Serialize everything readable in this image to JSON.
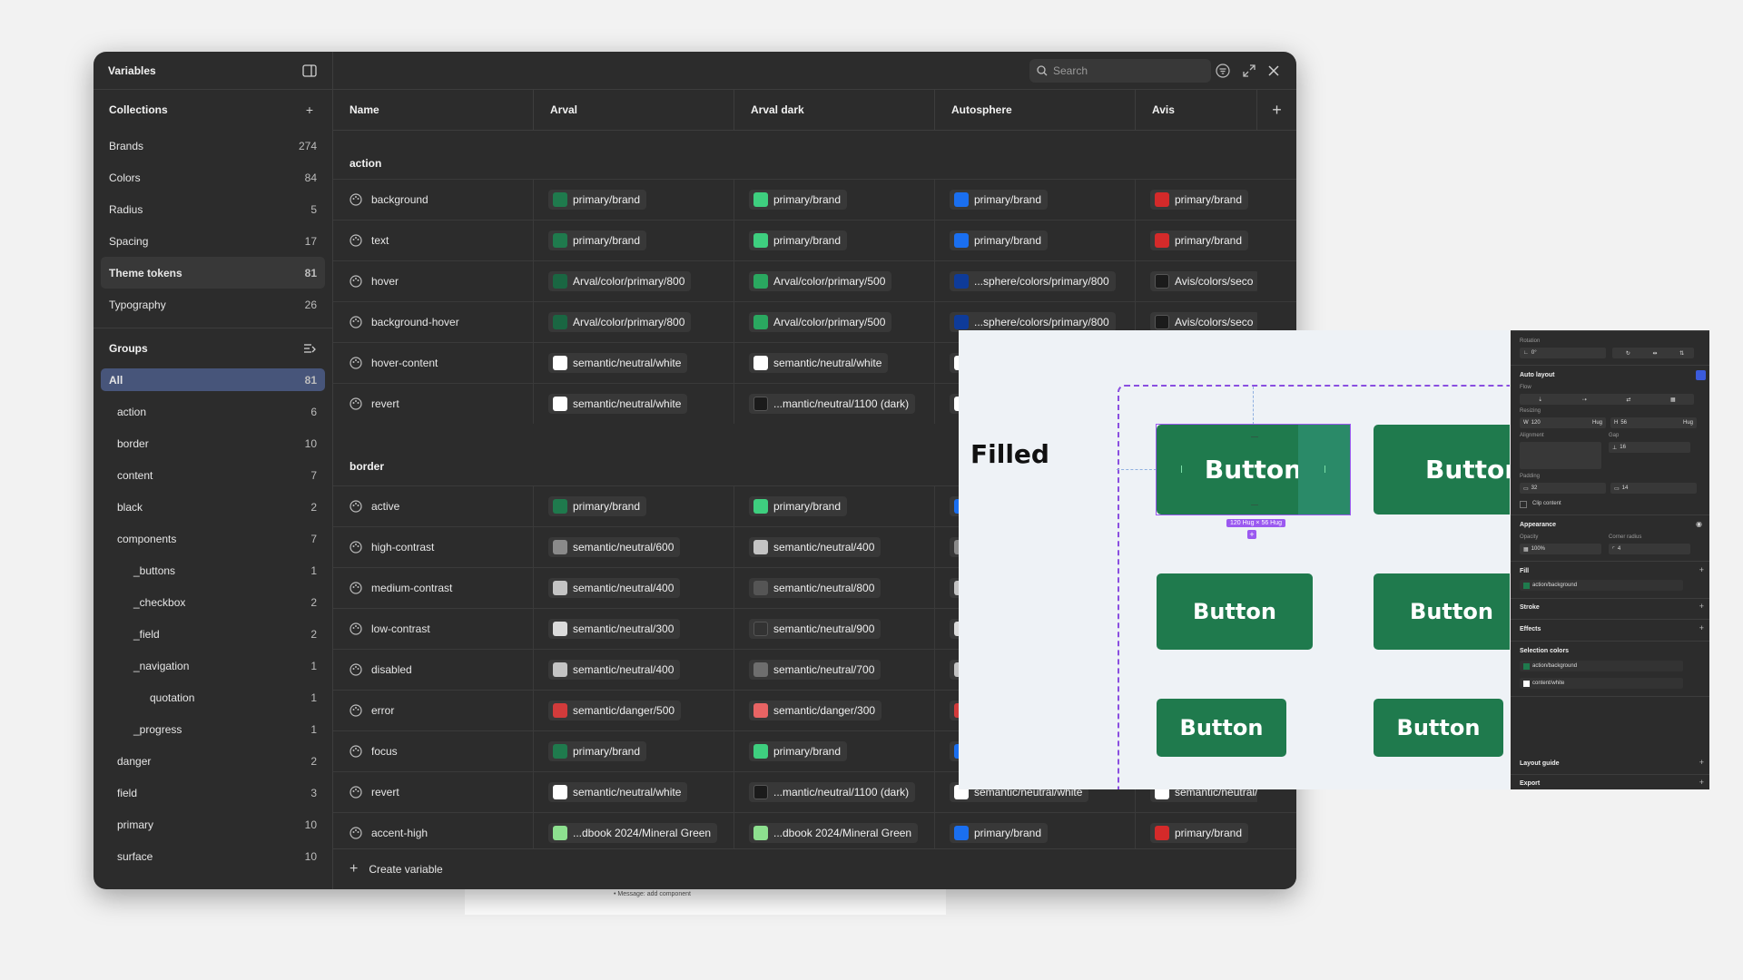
{
  "background_note": "• Message: add component",
  "sidebar": {
    "title": "Variables",
    "collections_label": "Collections",
    "collections": [
      {
        "label": "Brands",
        "count": "274"
      },
      {
        "label": "Colors",
        "count": "84"
      },
      {
        "label": "Radius",
        "count": "5"
      },
      {
        "label": "Spacing",
        "count": "17"
      },
      {
        "label": "Theme tokens",
        "count": "81",
        "active": true
      },
      {
        "label": "Typography",
        "count": "26"
      }
    ],
    "groups_label": "Groups",
    "groups": [
      {
        "label": "All",
        "count": "81",
        "level": 0,
        "active": true
      },
      {
        "label": "action",
        "count": "6",
        "level": 1
      },
      {
        "label": "border",
        "count": "10",
        "level": 1
      },
      {
        "label": "content",
        "count": "7",
        "level": 1
      },
      {
        "label": "black",
        "count": "2",
        "level": 1
      },
      {
        "label": "components",
        "count": "7",
        "level": 1
      },
      {
        "label": "_buttons",
        "count": "1",
        "level": 2
      },
      {
        "label": "_checkbox",
        "count": "2",
        "level": 2
      },
      {
        "label": "_field",
        "count": "2",
        "level": 2
      },
      {
        "label": "_navigation",
        "count": "1",
        "level": 2
      },
      {
        "label": "quotation",
        "count": "1",
        "level": 3
      },
      {
        "label": "_progress",
        "count": "1",
        "level": 2
      },
      {
        "label": "danger",
        "count": "2",
        "level": 1
      },
      {
        "label": "field",
        "count": "3",
        "level": 1
      },
      {
        "label": "primary",
        "count": "10",
        "level": 1
      },
      {
        "label": "surface",
        "count": "10",
        "level": 1
      }
    ]
  },
  "toolbar": {
    "search_placeholder": "Search"
  },
  "table": {
    "columns": [
      "Name",
      "Arval",
      "Arval dark",
      "Autosphere",
      "Avis"
    ],
    "groups": [
      {
        "title": "action",
        "rows": [
          {
            "name": "background",
            "values": [
              {
                "text": "primary/brand",
                "color": "#1f7a4d"
              },
              {
                "text": "primary/brand",
                "color": "#3ecf7f"
              },
              {
                "text": "primary/brand",
                "color": "#1a6ff0"
              },
              {
                "text": "primary/brand",
                "color": "#d42a2a"
              }
            ]
          },
          {
            "name": "text",
            "values": [
              {
                "text": "primary/brand",
                "color": "#1f7a4d"
              },
              {
                "text": "primary/brand",
                "color": "#3ecf7f"
              },
              {
                "text": "primary/brand",
                "color": "#1a6ff0"
              },
              {
                "text": "primary/brand",
                "color": "#d42a2a"
              }
            ]
          },
          {
            "name": "hover",
            "values": [
              {
                "text": "Arval/color/primary/800",
                "color": "#1a6642"
              },
              {
                "text": "Arval/color/primary/500",
                "color": "#2aa860"
              },
              {
                "text": "...sphere/colors/primary/800",
                "color": "#0e3b99"
              },
              {
                "text": "Avis/colors/seco",
                "color": "#1b1b1b"
              }
            ]
          },
          {
            "name": "background-hover",
            "values": [
              {
                "text": "Arval/color/primary/800",
                "color": "#1a6642"
              },
              {
                "text": "Arval/color/primary/500",
                "color": "#2aa860"
              },
              {
                "text": "...sphere/colors/primary/800",
                "color": "#0e3b99"
              },
              {
                "text": "Avis/colors/seco",
                "color": "#1b1b1b"
              }
            ]
          },
          {
            "name": "hover-content",
            "values": [
              {
                "text": "semantic/neutral/white",
                "color": "#ffffff"
              },
              {
                "text": "semantic/neutral/white",
                "color": "#ffffff"
              },
              {
                "text": "",
                "color": "#ffffff"
              },
              {
                "text": "",
                "color": ""
              }
            ]
          },
          {
            "name": "revert",
            "values": [
              {
                "text": "semantic/neutral/white",
                "color": "#ffffff"
              },
              {
                "text": "...mantic/neutral/1100 (dark)",
                "color": "#1b1b1b"
              },
              {
                "text": "",
                "color": "#ffffff"
              },
              {
                "text": "",
                "color": ""
              }
            ]
          }
        ]
      },
      {
        "title": "border",
        "rows": [
          {
            "name": "active",
            "values": [
              {
                "text": "primary/brand",
                "color": "#1f7a4d"
              },
              {
                "text": "primary/brand",
                "color": "#3ecf7f"
              },
              {
                "text": "",
                "color": "#1a6ff0"
              },
              {
                "text": "",
                "color": ""
              }
            ]
          },
          {
            "name": "high-contrast",
            "values": [
              {
                "text": "semantic/neutral/600",
                "color": "#8a8a8a"
              },
              {
                "text": "semantic/neutral/400",
                "color": "#c4c4c4"
              },
              {
                "text": "",
                "color": "#8a8a8a"
              },
              {
                "text": "",
                "color": ""
              }
            ]
          },
          {
            "name": "medium-contrast",
            "values": [
              {
                "text": "semantic/neutral/400",
                "color": "#c4c4c4"
              },
              {
                "text": "semantic/neutral/800",
                "color": "#555555"
              },
              {
                "text": "",
                "color": "#c4c4c4"
              },
              {
                "text": "",
                "color": ""
              }
            ]
          },
          {
            "name": "low-contrast",
            "values": [
              {
                "text": "semantic/neutral/300",
                "color": "#dcdcdc"
              },
              {
                "text": "semantic/neutral/900",
                "color": "#333333"
              },
              {
                "text": "",
                "color": "#dcdcdc"
              },
              {
                "text": "",
                "color": ""
              }
            ]
          },
          {
            "name": "disabled",
            "values": [
              {
                "text": "semantic/neutral/400",
                "color": "#c4c4c4"
              },
              {
                "text": "semantic/neutral/700",
                "color": "#6e6e6e"
              },
              {
                "text": "",
                "color": "#c4c4c4"
              },
              {
                "text": "",
                "color": ""
              }
            ]
          },
          {
            "name": "error",
            "values": [
              {
                "text": "semantic/danger/500",
                "color": "#d23b3b"
              },
              {
                "text": "semantic/danger/300",
                "color": "#e86464"
              },
              {
                "text": "",
                "color": "#d23b3b"
              },
              {
                "text": "",
                "color": ""
              }
            ]
          },
          {
            "name": "focus",
            "values": [
              {
                "text": "primary/brand",
                "color": "#1f7a4d"
              },
              {
                "text": "primary/brand",
                "color": "#3ecf7f"
              },
              {
                "text": "",
                "color": "#1a6ff0"
              },
              {
                "text": "",
                "color": ""
              }
            ]
          },
          {
            "name": "revert",
            "values": [
              {
                "text": "semantic/neutral/white",
                "color": "#ffffff"
              },
              {
                "text": "...mantic/neutral/1100 (dark)",
                "color": "#1b1b1b"
              },
              {
                "text": "semantic/neutral/white",
                "color": "#ffffff"
              },
              {
                "text": "semantic/neutral/white",
                "color": "#ffffff"
              }
            ]
          },
          {
            "name": "accent-high",
            "values": [
              {
                "text": "...dbook 2024/Mineral Green",
                "color": "#8de08f"
              },
              {
                "text": "...dbook 2024/Mineral Green",
                "color": "#8de08f"
              },
              {
                "text": "primary/brand",
                "color": "#1a6ff0"
              },
              {
                "text": "primary/brand",
                "color": "#d42a2a"
              }
            ]
          }
        ]
      }
    ],
    "create_label": "Create variable"
  },
  "canvas": {
    "section_label": "Filled",
    "button_label": "Button",
    "selection_badge": "120 Hug × 56 Hug",
    "brand_color": "#1f7a4d"
  },
  "properties": {
    "rotation_label": "Rotation",
    "rotation_value": "0°",
    "auto_layout": "Auto layout",
    "flow": "Flow",
    "resizing": "Resizing",
    "width": "120",
    "width_mode": "Hug",
    "height": "56",
    "height_mode": "Hug",
    "alignment": "Alignment",
    "gap_label": "Gap",
    "gap": "16",
    "padding": "Padding",
    "padding_h": "32",
    "padding_v": "14",
    "clip": "Clip content",
    "appearance": "Appearance",
    "opacity_label": "Opacity",
    "opacity": "100%",
    "radius_label": "Corner radius",
    "radius": "4",
    "fill": "Fill",
    "fill_value": "action/background",
    "stroke": "Stroke",
    "effects": "Effects",
    "selection_colors": "Selection colors",
    "sel_color_1": "action/background",
    "sel_color_2": "content/white",
    "layout_guide": "Layout guide",
    "export": "Export"
  }
}
